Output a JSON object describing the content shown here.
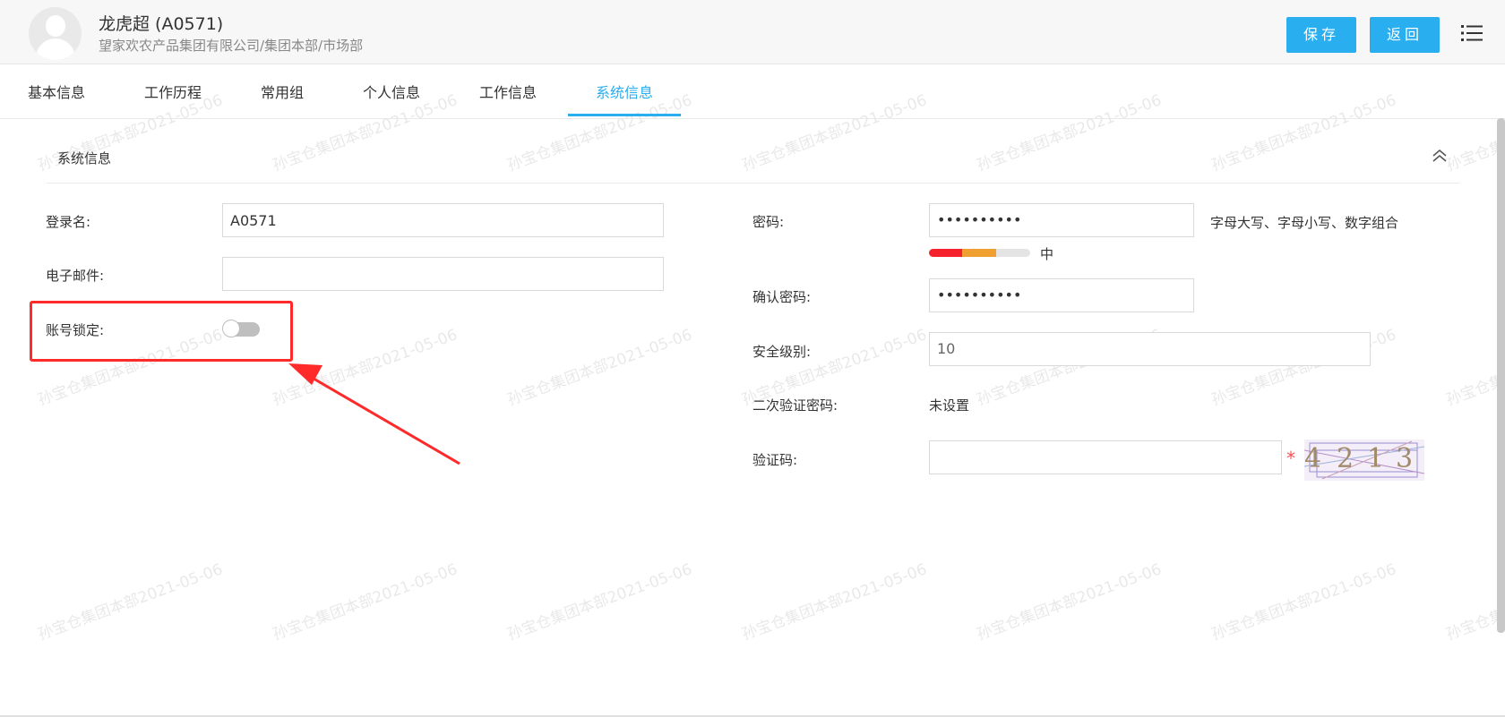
{
  "header": {
    "name": "龙虎超 (A0571)",
    "org_path": "望家欢农产品集团有限公司/集团本部/市场部",
    "save_label": "保存",
    "back_label": "返回",
    "menu_icon": "list-menu-icon",
    "avatar_icon": "user-avatar-icon"
  },
  "tabs": [
    {
      "label": "基本信息",
      "active": false
    },
    {
      "label": "工作历程",
      "active": false
    },
    {
      "label": "常用组",
      "active": false
    },
    {
      "label": "个人信息",
      "active": false
    },
    {
      "label": "工作信息",
      "active": false
    },
    {
      "label": "系统信息",
      "active": true
    }
  ],
  "section": {
    "title": "系统信息",
    "collapse_icon": "double-chevron-up-icon"
  },
  "form_left": {
    "login_label": "登录名:",
    "login_value": "A0571",
    "email_label": "电子邮件:",
    "email_value": "",
    "lock_label": "账号锁定:",
    "lock_enabled": false
  },
  "form_right": {
    "password_label": "密码:",
    "password_value": "••••••••••",
    "password_hint": "字母大写、字母小写、数字组合",
    "strength_label": "中",
    "confirm_label": "确认密码:",
    "confirm_value": "••••••••••",
    "security_label": "安全级别:",
    "security_value": "10",
    "twofa_label": "二次验证密码:",
    "twofa_value": "未设置",
    "captcha_label": "验证码:",
    "captcha_value": "",
    "required_mark": "*",
    "captcha_digits": [
      "4",
      "2",
      "1",
      "3"
    ]
  },
  "watermark_text": "孙宝仓集团本部2021-05-06",
  "colors": {
    "accent": "#29aef0",
    "highlight": "#ff2a2a",
    "strength_weak": "#f5222d",
    "strength_medium": "#f0a030"
  }
}
